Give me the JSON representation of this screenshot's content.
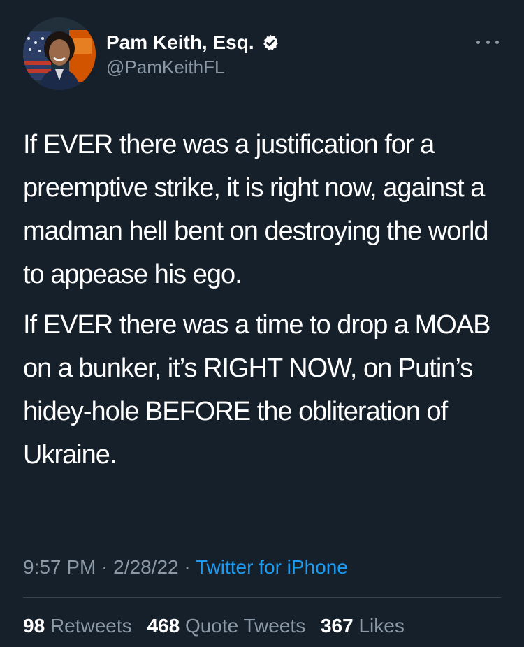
{
  "author": {
    "name": "Pam Keith, Esq.",
    "handle": "@PamKeithFL",
    "verified": true,
    "verified_icon": "verified-badge-icon"
  },
  "more_icon": "more-horizontal-icon",
  "tweet": {
    "paragraphs": [
      "If EVER there was a justification for a preemptive strike, it is right now, against a madman hell bent on destroying the world to appease his ego.",
      "If EVER there was a time to drop a MOAB on a bunker, it’s RIGHT NOW, on Putin’s hidey-hole BEFORE the obliteration of Ukraine."
    ]
  },
  "meta": {
    "time": "9:57 PM",
    "sep1": " · ",
    "date": "2/28/22",
    "sep2": " · ",
    "source": "Twitter for iPhone"
  },
  "stats": {
    "retweets_count": "98",
    "retweets_label": "Retweets",
    "quotes_count": "468",
    "quotes_label": "Quote Tweets",
    "likes_count": "367",
    "likes_label": "Likes"
  },
  "colors": {
    "background": "#15202b",
    "text": "#ffffff",
    "secondary": "#8b98a5",
    "link": "#1d9bf0",
    "divider": "#38444d"
  }
}
